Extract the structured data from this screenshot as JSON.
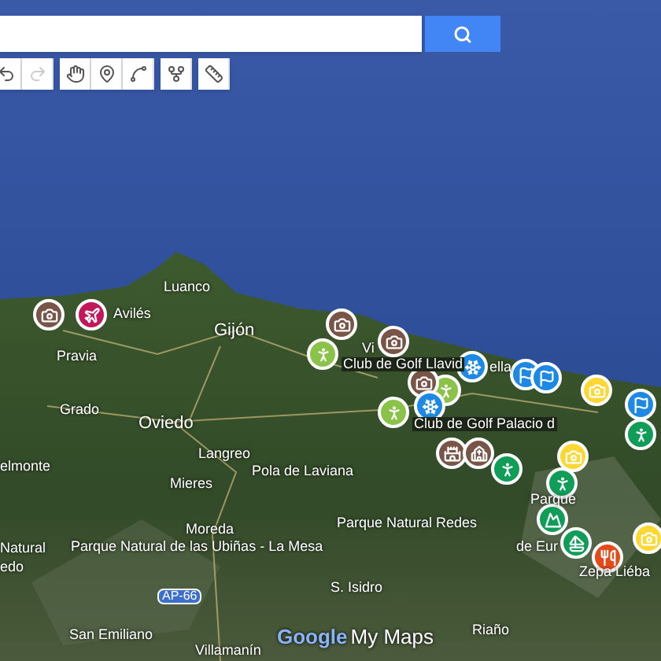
{
  "search": {
    "button": {
      "kind": "search"
    }
  },
  "toolbar": {
    "groups": [
      [
        {
          "kind": "undo",
          "disabled": false
        },
        {
          "kind": "redo",
          "disabled": true
        }
      ],
      [
        {
          "kind": "hand",
          "disabled": false
        },
        {
          "kind": "marker",
          "disabled": false
        },
        {
          "kind": "line",
          "disabled": false
        }
      ],
      [
        {
          "kind": "route",
          "disabled": false
        }
      ],
      [
        {
          "kind": "ruler",
          "disabled": false
        }
      ]
    ]
  },
  "map": {
    "labels": [
      {
        "text": "Luanco",
        "kind": "place"
      },
      {
        "text": "Avilés",
        "kind": "place"
      },
      {
        "text": "Gijón",
        "kind": "city"
      },
      {
        "text": "Pravia",
        "kind": "place"
      },
      {
        "text": "Grado",
        "kind": "place"
      },
      {
        "text": "Oviedo",
        "kind": "city"
      },
      {
        "text": "Langreo",
        "kind": "place"
      },
      {
        "text": "Mieres",
        "kind": "place"
      },
      {
        "text": "Pola de Laviana",
        "kind": "place"
      },
      {
        "text": "elmonte",
        "kind": "place"
      },
      {
        "text": "Moreda",
        "kind": "place"
      },
      {
        "text": "Natural",
        "kind": "park"
      },
      {
        "text": "edo",
        "kind": "park"
      },
      {
        "text": "Parque Natural de las Ubiñas - La Mesa",
        "kind": "park"
      },
      {
        "text": "San Emiliano",
        "kind": "place"
      },
      {
        "text": "Villamanín",
        "kind": "place"
      },
      {
        "text": "Vi",
        "kind": "place"
      },
      {
        "text": "Club de Golf Llavid",
        "kind": "poi"
      },
      {
        "text": "Club de Golf Palacio d",
        "kind": "poi"
      },
      {
        "text": "ella",
        "kind": "place"
      },
      {
        "text": "Parque Natural Redes",
        "kind": "park"
      },
      {
        "text": "S. Isidro",
        "kind": "place"
      },
      {
        "text": "Parque",
        "kind": "park"
      },
      {
        "text": "de Eur",
        "kind": "park"
      },
      {
        "text": "Zepa Liéba",
        "kind": "place"
      },
      {
        "text": "Riaño",
        "kind": "place"
      }
    ],
    "road_shield": "AP-66",
    "pins": [
      {
        "kind": "camera",
        "color": "#795548"
      },
      {
        "kind": "plane",
        "color": "#c2185b"
      },
      {
        "kind": "hiker",
        "color": "#8bc34a"
      },
      {
        "kind": "camera",
        "color": "#795548"
      },
      {
        "kind": "camera",
        "color": "#795548"
      },
      {
        "kind": "hiker",
        "color": "#8bc34a"
      },
      {
        "kind": "skier",
        "color": "#1e88e5"
      },
      {
        "kind": "camera",
        "color": "#795548"
      },
      {
        "kind": "skier",
        "color": "#1e88e5"
      },
      {
        "kind": "hiker",
        "color": "#8bc34a"
      },
      {
        "kind": "castle",
        "color": "#795548"
      },
      {
        "kind": "church",
        "color": "#795548"
      },
      {
        "kind": "hiker",
        "color": "#0f9d58"
      },
      {
        "kind": "golf",
        "color": "#1e88e5"
      },
      {
        "kind": "golf",
        "color": "#1e88e5"
      },
      {
        "kind": "camera",
        "color": "#fdd835"
      },
      {
        "kind": "golf",
        "color": "#1e88e5"
      },
      {
        "kind": "hiker",
        "color": "#0f9d58"
      },
      {
        "kind": "camera",
        "color": "#fdd835"
      },
      {
        "kind": "hiker",
        "color": "#0f9d58"
      },
      {
        "kind": "mountain",
        "color": "#0f9d58"
      },
      {
        "kind": "boat",
        "color": "#0f9d58"
      },
      {
        "kind": "food",
        "color": "#e64a19"
      },
      {
        "kind": "camera",
        "color": "#fdd835"
      }
    ]
  },
  "logo": {
    "brand": "Google",
    "product": "My Maps"
  }
}
